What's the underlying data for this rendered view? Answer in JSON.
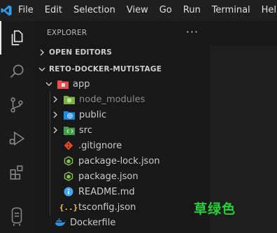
{
  "menu": {
    "items": [
      "File",
      "Edit",
      "Selection",
      "View",
      "Go",
      "Run",
      "Terminal",
      "Help"
    ]
  },
  "activity_bar": {
    "icons": [
      "files-icon",
      "search-icon",
      "source-control-icon",
      "run-debug-icon",
      "extensions-icon",
      "docker-icon"
    ]
  },
  "explorer": {
    "title": "EXPLORER",
    "more_label": "···",
    "open_editors_label": "OPEN EDITORS",
    "folder_label": "RETO-DOCKER-MUTISTAGE",
    "tree": [
      {
        "label": "app",
        "icon": "folder-app-icon",
        "color": "#e94f4f"
      },
      {
        "label": "node_modules",
        "icon": "folder-node-icon",
        "color": "#8bc34a"
      },
      {
        "label": "public",
        "icon": "folder-public-icon",
        "color": "#42a5f5"
      },
      {
        "label": "src",
        "icon": "folder-src-icon",
        "color": "#4caf50"
      },
      {
        "label": ".gitignore",
        "icon": "git-icon",
        "color": "#e64a19"
      },
      {
        "label": "package-lock.json",
        "icon": "nodejs-icon",
        "color": "#8bc34a"
      },
      {
        "label": "package.json",
        "icon": "nodejs-icon",
        "color": "#8bc34a"
      },
      {
        "label": "README.md",
        "icon": "info-icon",
        "color": "#42a5f5"
      },
      {
        "label": "tsconfig.json",
        "icon": "json-braces-icon",
        "color": "#f9c74f"
      },
      {
        "label": "Dockerfile",
        "icon": "docker-file-icon",
        "color": "#2496ed"
      }
    ]
  },
  "watermark": "草绿色",
  "colors": {
    "accent": "#0078d4",
    "watermark": "#27d13a"
  }
}
